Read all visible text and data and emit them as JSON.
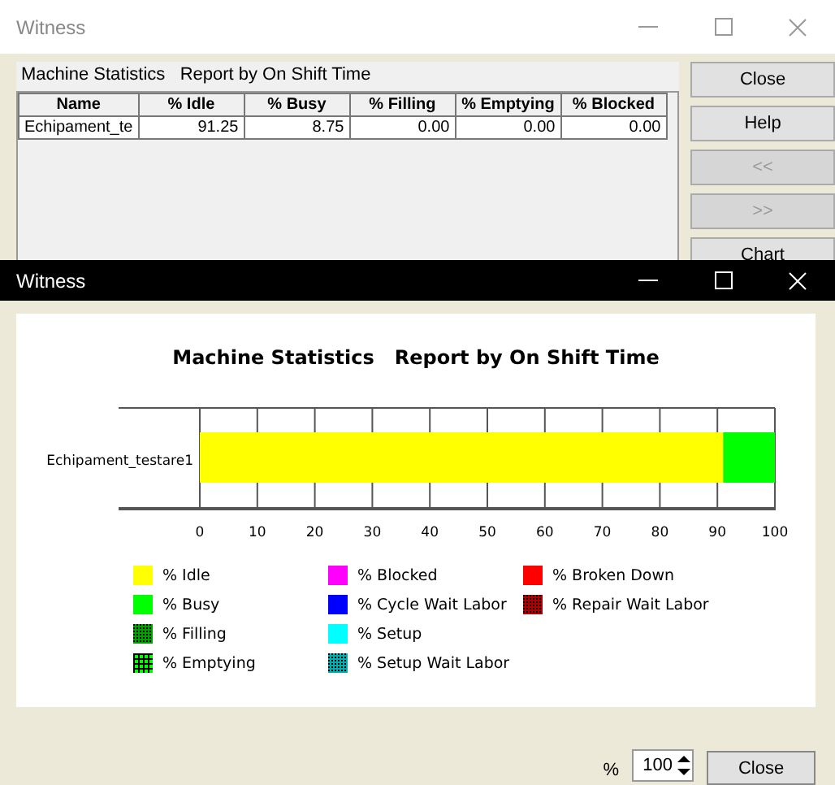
{
  "report_window": {
    "title": "Witness",
    "report_label": "Machine Statistics   Report by On Shift Time",
    "table": {
      "columns": [
        "Name",
        "% Idle",
        "% Busy",
        "% Filling",
        "% Emptying",
        "% Blocked"
      ],
      "rows": [
        [
          "Echipament_te",
          "91.25",
          "8.75",
          "0.00",
          "0.00",
          "0.00"
        ]
      ]
    },
    "buttons": [
      {
        "label": "Close",
        "disabled": false
      },
      {
        "label": "Help",
        "disabled": false
      },
      {
        "label": "<<",
        "disabled": true
      },
      {
        "label": ">>",
        "disabled": true
      },
      {
        "label": "Chart",
        "disabled": false
      }
    ]
  },
  "chart_window": {
    "title": "Witness",
    "chart_data": {
      "type": "bar",
      "orientation": "horizontal",
      "stacked": true,
      "grid": true,
      "title": "Machine Statistics   Report by On Shift Time",
      "categories": [
        "Echipament_testare1"
      ],
      "series": [
        {
          "name": "% Idle",
          "color": "#ffff00",
          "values": [
            91
          ]
        },
        {
          "name": "% Busy",
          "color": "#00ff00",
          "values": [
            9
          ]
        },
        {
          "name": "% Filling",
          "color": "#00a000",
          "values": [
            0
          ]
        },
        {
          "name": "% Emptying",
          "color": "#00ff00",
          "values": [
            0
          ]
        },
        {
          "name": "% Blocked",
          "color": "#ff00ff",
          "values": [
            0
          ]
        },
        {
          "name": "% Cycle Wait Labor",
          "color": "#0000ff",
          "values": [
            0
          ]
        },
        {
          "name": "% Setup",
          "color": "#00ffff",
          "values": [
            0
          ]
        },
        {
          "name": "% Setup Wait Labor",
          "color": "#00b0b0",
          "values": [
            0
          ]
        },
        {
          "name": "% Broken Down",
          "color": "#ff0000",
          "values": [
            0
          ]
        },
        {
          "name": "% Repair Wait Labor",
          "color": "#b00000",
          "values": [
            0
          ]
        }
      ],
      "xlim": [
        0,
        100
      ],
      "xticks": [
        0,
        10,
        20,
        30,
        40,
        50,
        60,
        70,
        80,
        90,
        100
      ]
    },
    "legend_swatches": [
      {
        "kind": "solid"
      },
      {
        "kind": "solid"
      },
      {
        "kind": "checker"
      },
      {
        "kind": "grid"
      },
      {
        "kind": "solid"
      },
      {
        "kind": "solid"
      },
      {
        "kind": "solid"
      },
      {
        "kind": "checker"
      },
      {
        "kind": "solid"
      },
      {
        "kind": "checker"
      }
    ],
    "zoom_label": "%",
    "zoom_value": "100",
    "close_label": "Close"
  }
}
